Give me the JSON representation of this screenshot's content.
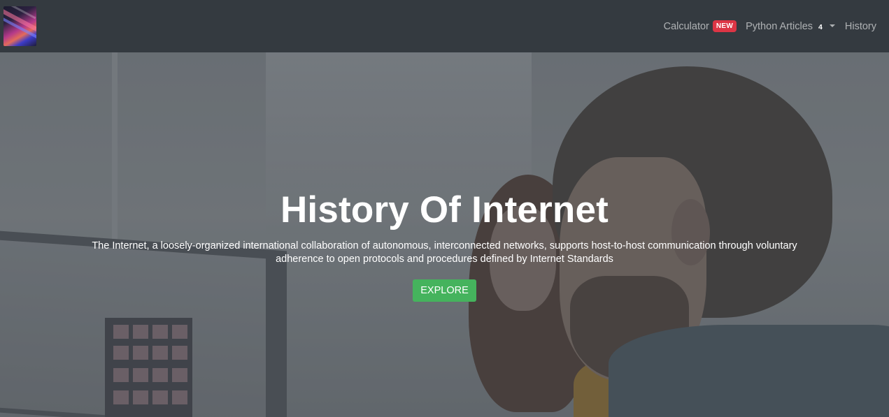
{
  "navbar": {
    "logo_icon": "laptop-keyboard-gradient-logo",
    "items": [
      {
        "label": "Calculator",
        "badge": "NEW",
        "badge_color": "#dc3545"
      },
      {
        "label": "Python Articles",
        "count": "4",
        "has_dropdown": true
      },
      {
        "label": "History"
      }
    ]
  },
  "hero": {
    "title": "History Of Internet",
    "description": "The Internet, a loosely-organized international collaboration of autonomous, interconnected networks, supports host-to-host communication through voluntary adherence to open protocols and procedures defined by Internet Standards",
    "button_label": "EXPLORE",
    "button_color": "#45b35d"
  }
}
